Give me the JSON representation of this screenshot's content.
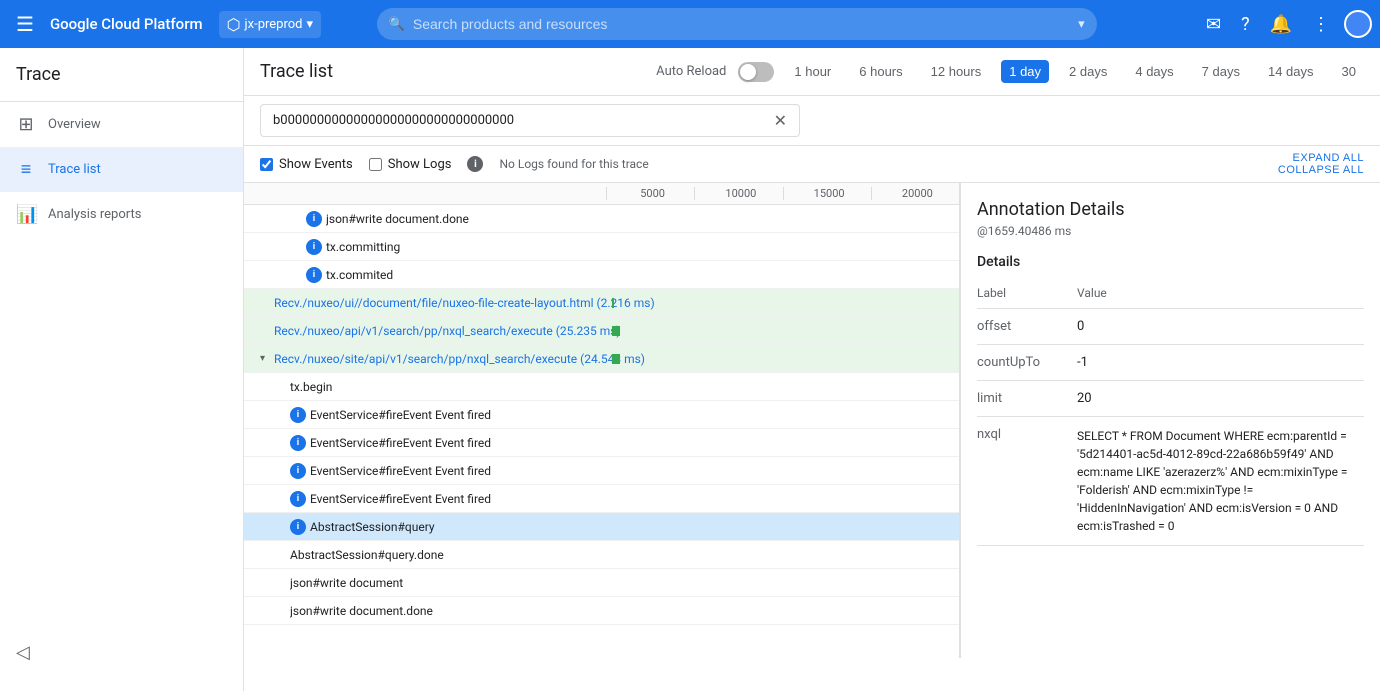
{
  "nav": {
    "menu_icon": "≡",
    "logo": "Google Cloud Platform",
    "project": "jx-preprod",
    "search_placeholder": "Search products and resources",
    "icons": [
      "✉",
      "?",
      "🔔",
      "⋮"
    ]
  },
  "sidebar": {
    "title": "Trace",
    "items": [
      {
        "id": "overview",
        "label": "Overview",
        "icon": "⊞"
      },
      {
        "id": "trace-list",
        "label": "Trace list",
        "icon": "≡"
      },
      {
        "id": "analysis-reports",
        "label": "Analysis reports",
        "icon": "📊"
      }
    ],
    "active": "trace-list"
  },
  "trace_list": {
    "title": "Trace list",
    "auto_reload_label": "Auto Reload",
    "time_buttons": [
      {
        "label": "1 hour",
        "active": false
      },
      {
        "label": "6 hours",
        "active": false
      },
      {
        "label": "12 hours",
        "active": false
      },
      {
        "label": "1 day",
        "active": true
      },
      {
        "label": "2 days",
        "active": false
      },
      {
        "label": "4 days",
        "active": false
      },
      {
        "label": "7 days",
        "active": false
      },
      {
        "label": "14 days",
        "active": false
      },
      {
        "label": "30",
        "active": false
      }
    ],
    "search_value": "b00000000000000000000000000000000",
    "show_events_label": "Show Events",
    "show_logs_label": "Show Logs",
    "no_logs_text": "No Logs found for this trace",
    "expand_all": "EXPAND ALL",
    "collapse_all": "COLLAPSE ALL",
    "scale_marks": [
      "5000",
      "10000",
      "15000",
      "20000"
    ],
    "rows": [
      {
        "indent": 1,
        "icon": true,
        "label": "json#write document.done",
        "highlighted": false
      },
      {
        "indent": 1,
        "icon": true,
        "label": "tx.committing",
        "highlighted": false
      },
      {
        "indent": 1,
        "icon": true,
        "label": "tx.commited",
        "highlighted": false
      },
      {
        "indent": 0,
        "icon": false,
        "label": "Recv./nuxeo/ui//document/file/nuxeo-file-create-layout.html (2.216 ms)",
        "isRecv": true,
        "highlighted": false
      },
      {
        "indent": 0,
        "icon": false,
        "label": "Recv./nuxeo/api/v1/search/pp/nxql_search/execute (25.235 ms)",
        "isRecv": true,
        "highlighted": false
      },
      {
        "indent": 0,
        "icon": false,
        "label": "Recv./nuxeo/site/api/v1/search/pp/nxql_search/execute (24.543 ms)",
        "isRecv": true,
        "hasToggle": true,
        "highlighted": false
      },
      {
        "indent": 1,
        "icon": false,
        "label": "tx.begin",
        "highlighted": false
      },
      {
        "indent": 1,
        "icon": true,
        "label": "EventService#fireEvent Event fired",
        "highlighted": false
      },
      {
        "indent": 1,
        "icon": true,
        "label": "EventService#fireEvent Event fired",
        "highlighted": false
      },
      {
        "indent": 1,
        "icon": true,
        "label": "EventService#fireEvent Event fired",
        "highlighted": false
      },
      {
        "indent": 1,
        "icon": true,
        "label": "EventService#fireEvent Event fired",
        "highlighted": false
      },
      {
        "indent": 1,
        "icon": true,
        "label": "AbstractSession#query",
        "highlighted": true
      },
      {
        "indent": 1,
        "icon": false,
        "label": "AbstractSession#query.done",
        "highlighted": false
      },
      {
        "indent": 1,
        "icon": false,
        "label": "json#write document",
        "highlighted": false
      },
      {
        "indent": 1,
        "icon": false,
        "label": "json#write document.done",
        "highlighted": false
      }
    ]
  },
  "annotation": {
    "title": "Annotation Details",
    "subtitle": "@1659.40486 ms",
    "section": "Details",
    "label_col": "Label",
    "value_col": "Value",
    "rows": [
      {
        "label": "offset",
        "value": "0"
      },
      {
        "label": "countUpTo",
        "value": "-1"
      },
      {
        "label": "limit",
        "value": "20"
      },
      {
        "label": "nxql",
        "value": "SELECT * FROM Document WHERE ecm:parentId = '5d214401-ac5d-4012-89cd-22a686b59f49' AND ecm:name LIKE 'azerazerz%' AND ecm:mixinType = 'Folderish' AND ecm:mixinType != 'HiddenInNavigation' AND ecm:isVersion = 0 AND ecm:isTrashed = 0"
      }
    ]
  }
}
